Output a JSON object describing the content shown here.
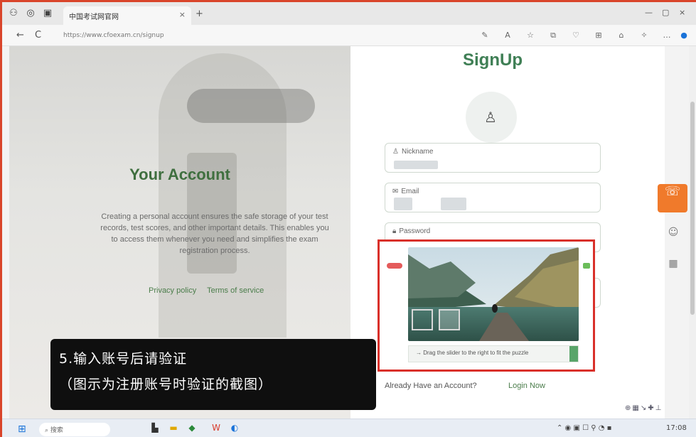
{
  "browser": {
    "tab_title": "中国考试网官网",
    "url": "https://www.cfoexam.cn/signup",
    "tab_close": "×",
    "new_tab": "+",
    "window_controls": [
      "—",
      "▢",
      "×"
    ],
    "nav": [
      "←",
      "C"
    ],
    "extensions": [
      "✎",
      "A",
      "☆",
      "⧉",
      "♡",
      "⊞",
      "⌂",
      "✧",
      "…",
      "●"
    ]
  },
  "left": {
    "title": "Your Account",
    "description": "Creating a personal account ensures the safe storage of your test records, test scores, and other important details. This enables you to access them whenever you need and simplifies the exam registration process.",
    "links": [
      "Privacy policy",
      "Terms of service"
    ]
  },
  "signup": {
    "title": "SignUp",
    "avatar_icon": "user-icon",
    "fields": [
      {
        "label": "Nickname",
        "icon": "user-outline-icon"
      },
      {
        "label": "Email",
        "icon": "mail-icon"
      },
      {
        "label": "Password",
        "icon": "lock-icon"
      }
    ],
    "already": "Already Have an Account?",
    "login": "Login Now"
  },
  "captcha": {
    "instruction": "Drag the slider to the right to fit the puzzle",
    "slider_arrow": "→"
  },
  "caption": {
    "line1": "5.输入账号后请验证",
    "line2": "（图示为注册账号时验证的截图）"
  },
  "taskbar": {
    "search": "搜索",
    "time": "17:08"
  },
  "colors": {
    "accent_green": "#3f7f55",
    "captcha_border": "#d9302a",
    "float_orange": "#f07a2b"
  }
}
